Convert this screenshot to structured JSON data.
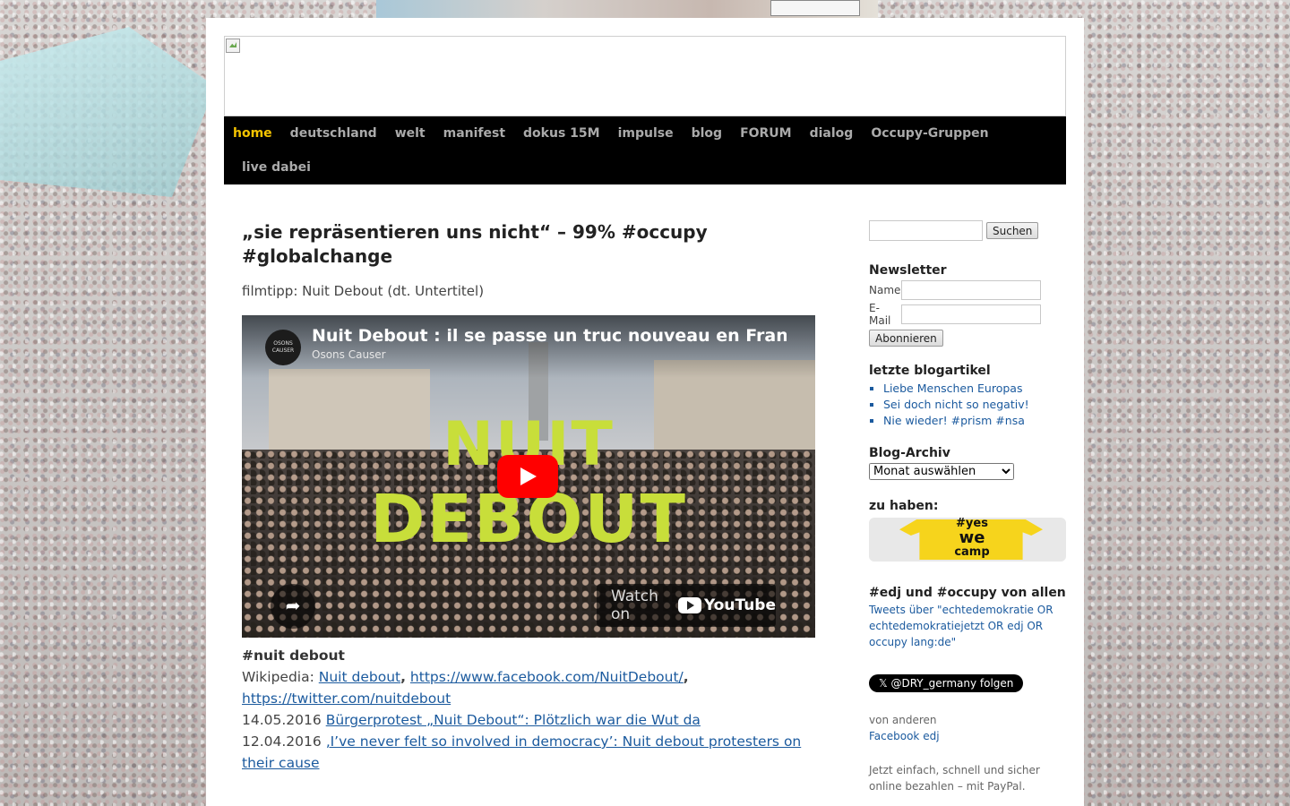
{
  "nav": {
    "items": [
      "home",
      "deutschland",
      "welt",
      "manifest",
      "dokus 15M",
      "impulse",
      "blog",
      "FORUM",
      "dialog",
      "Occupy-Gruppen",
      "live dabei"
    ],
    "active": "home"
  },
  "post": {
    "title": "„sie repräsentieren uns nicht“ – 99% #occupy #globalchange",
    "filmtipp": "filmtipp:  Nuit Debout (dt. Untertitel)",
    "video": {
      "title": "Nuit Debout : il se passe un truc nouveau en France",
      "channel": "Osons Causer",
      "avatar_text": "OSONS CAUSER",
      "overlay_line1": "NUIT",
      "overlay_line2": "DEBOUT",
      "watch_on": "Watch on",
      "youtube": "YouTube"
    },
    "hashtag": "#nuit debout",
    "wikipedia_label": "Wikipedia:",
    "link_wiki": "Nuit debout",
    "link_facebook": "https://www.facebook.com/NuitDebout/",
    "link_twitter": "https://twitter.com/nuitdebout",
    "entries": [
      {
        "date": "14.05.2016",
        "link": "Bürgerprotest „Nuit Debout“: Plötzlich war die Wut da"
      },
      {
        "date": "12.04.2016",
        "link": "‚I’ve never felt so involved in democracy’: Nuit debout protesters on their cause"
      }
    ]
  },
  "sidebar": {
    "search_button": "Suchen",
    "newsletter_title": "Newsletter",
    "name_label": "Name",
    "email_label": "E-Mail",
    "subscribe_button": "Abonnieren",
    "blog_title": "letzte blogartikel",
    "blog_items": [
      "Liebe Menschen Europas",
      "Sei doch nicht so negativ!",
      "Nie wieder! #prism #nsa"
    ],
    "archive_title": "Blog-Archiv",
    "archive_select": "Monat auswählen",
    "zu_haben_title": "zu haben:",
    "shirt_line1": "#yes",
    "shirt_line2": "we",
    "shirt_line3": "camp",
    "edj_title": "#edj und #occupy von allen",
    "edj_link": "Tweets über \"echtedemokratie OR echtedemokratiejetzt OR edj OR occupy lang:de\"",
    "follow_button": "𝕏 @DRY_germany folgen",
    "von_anderen": "von anderen",
    "facebook_edj": "Facebook edj",
    "paypal_alt": "Jetzt einfach, schnell und sicher online bezahlen – mit PayPal."
  },
  "colors": {
    "nav_bg": "#000000",
    "nav_active": "#f5c400",
    "link": "#1b5a9e",
    "play_red": "#ff0000",
    "nuit_green": "#c8de3a"
  }
}
